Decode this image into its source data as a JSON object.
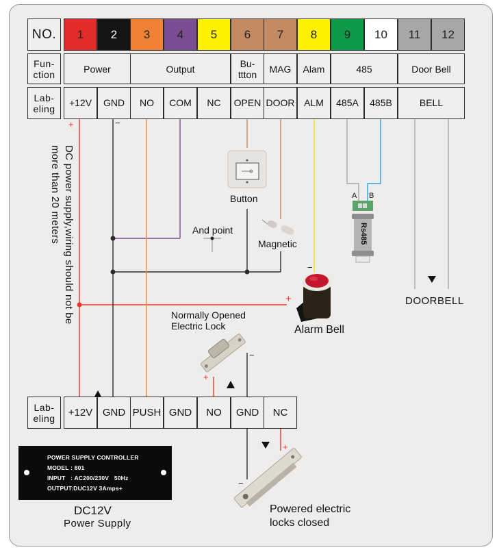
{
  "table": {
    "row_headers": {
      "no": "NO.",
      "function": "Fun-\nction",
      "labeling": "Lab-\neling"
    },
    "terminals": [
      {
        "no": "1",
        "color": "#e32b2b",
        "text_color": "#222222",
        "label": "+12V"
      },
      {
        "no": "2",
        "color": "#141414",
        "text_color": "#ffffff",
        "label": "GND"
      },
      {
        "no": "3",
        "color": "#ef8132",
        "text_color": "#222222",
        "label": "NO"
      },
      {
        "no": "4",
        "color": "#7b4d93",
        "text_color": "#222222",
        "label": "COM"
      },
      {
        "no": "5",
        "color": "#fff200",
        "text_color": "#222222",
        "label": "NC"
      },
      {
        "no": "6",
        "color": "#c48a62",
        "text_color": "#222222",
        "label": "OPEN"
      },
      {
        "no": "7",
        "color": "#c48a62",
        "text_color": "#222222",
        "label": "DOOR"
      },
      {
        "no": "8",
        "color": "#fff200",
        "text_color": "#222222",
        "label": "ALM"
      },
      {
        "no": "9",
        "color": "#0e9a47",
        "text_color": "#222222",
        "label": "485A"
      },
      {
        "no": "10",
        "color": "#ffffff",
        "text_color": "#222222",
        "label": "485B"
      },
      {
        "no": "11",
        "color": "#a7a7a7",
        "text_color": "#222222",
        "label": ""
      },
      {
        "no": "12",
        "color": "#a7a7a7",
        "text_color": "#222222",
        "label": ""
      }
    ],
    "functions": [
      "Power",
      "Output",
      "Bu-\nttton",
      "MAG",
      "Alam",
      "485",
      "Door Bell"
    ],
    "bell_label": "BELL"
  },
  "bottom_table": {
    "header": "Lab-\neling",
    "labels": [
      "+12V",
      "GND",
      "PUSH",
      "GND",
      "NO",
      "GND",
      "NC"
    ]
  },
  "components": {
    "button": "Button",
    "and_point": "And point",
    "magnetic": "Magnetic",
    "alarm_bell": "Alarm Bell",
    "no_lock": "Normally Opened\nElectric Lock",
    "powered_lock_1": "Powered electric",
    "powered_lock_2": "locks closed",
    "rs485": "Rs485",
    "rs485_a": "A",
    "rs485_b": "B",
    "doorbell": "DOORBELL"
  },
  "note": "DC power supply,wiring should not be more than 20 meters",
  "polarity": {
    "plus": "+",
    "minus": "−"
  },
  "power_supply": {
    "plate_lines": [
      "POWER SUPPLY CONTROLLER",
      "MODEL : 801",
      "INPUT   : AC200/230V   50Hz",
      "OUTPUT:DUC12V  3Amps+"
    ],
    "title": "DC12V",
    "subtitle": "Power Supply"
  },
  "colors": {
    "red_wire": "#e53a2c",
    "black_wire": "#2b2b2b",
    "orange_wire": "#ef8a3a",
    "purple_wire": "#7b4d93",
    "yellow_wire": "#f5e21c",
    "brown_wire": "#c8875c",
    "gray_wire": "#a8a8a8",
    "blue_wire": "#2aa3dc"
  }
}
